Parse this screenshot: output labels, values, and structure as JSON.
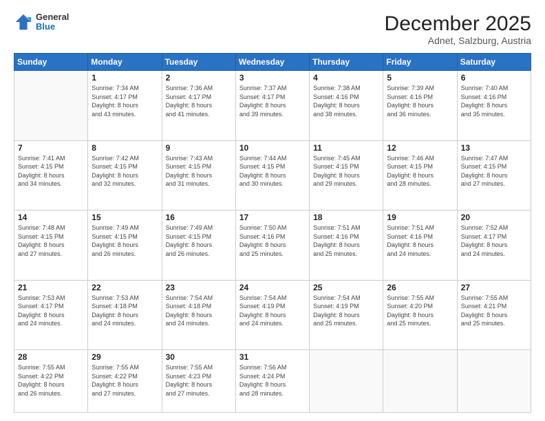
{
  "header": {
    "logo_line1": "General",
    "logo_line2": "Blue",
    "title": "December 2025",
    "subtitle": "Adnet, Salzburg, Austria"
  },
  "weekdays": [
    "Sunday",
    "Monday",
    "Tuesday",
    "Wednesday",
    "Thursday",
    "Friday",
    "Saturday"
  ],
  "weeks": [
    [
      {
        "day": "",
        "info": ""
      },
      {
        "day": "1",
        "info": "Sunrise: 7:34 AM\nSunset: 4:17 PM\nDaylight: 8 hours\nand 43 minutes."
      },
      {
        "day": "2",
        "info": "Sunrise: 7:36 AM\nSunset: 4:17 PM\nDaylight: 8 hours\nand 41 minutes."
      },
      {
        "day": "3",
        "info": "Sunrise: 7:37 AM\nSunset: 4:17 PM\nDaylight: 8 hours\nand 39 minutes."
      },
      {
        "day": "4",
        "info": "Sunrise: 7:38 AM\nSunset: 4:16 PM\nDaylight: 8 hours\nand 38 minutes."
      },
      {
        "day": "5",
        "info": "Sunrise: 7:39 AM\nSunset: 4:16 PM\nDaylight: 8 hours\nand 36 minutes."
      },
      {
        "day": "6",
        "info": "Sunrise: 7:40 AM\nSunset: 4:16 PM\nDaylight: 8 hours\nand 35 minutes."
      }
    ],
    [
      {
        "day": "7",
        "info": "Sunrise: 7:41 AM\nSunset: 4:15 PM\nDaylight: 8 hours\nand 34 minutes."
      },
      {
        "day": "8",
        "info": "Sunrise: 7:42 AM\nSunset: 4:15 PM\nDaylight: 8 hours\nand 32 minutes."
      },
      {
        "day": "9",
        "info": "Sunrise: 7:43 AM\nSunset: 4:15 PM\nDaylight: 8 hours\nand 31 minutes."
      },
      {
        "day": "10",
        "info": "Sunrise: 7:44 AM\nSunset: 4:15 PM\nDaylight: 8 hours\nand 30 minutes."
      },
      {
        "day": "11",
        "info": "Sunrise: 7:45 AM\nSunset: 4:15 PM\nDaylight: 8 hours\nand 29 minutes."
      },
      {
        "day": "12",
        "info": "Sunrise: 7:46 AM\nSunset: 4:15 PM\nDaylight: 8 hours\nand 28 minutes."
      },
      {
        "day": "13",
        "info": "Sunrise: 7:47 AM\nSunset: 4:15 PM\nDaylight: 8 hours\nand 27 minutes."
      }
    ],
    [
      {
        "day": "14",
        "info": "Sunrise: 7:48 AM\nSunset: 4:15 PM\nDaylight: 8 hours\nand 27 minutes."
      },
      {
        "day": "15",
        "info": "Sunrise: 7:49 AM\nSunset: 4:15 PM\nDaylight: 8 hours\nand 26 minutes."
      },
      {
        "day": "16",
        "info": "Sunrise: 7:49 AM\nSunset: 4:15 PM\nDaylight: 8 hours\nand 26 minutes."
      },
      {
        "day": "17",
        "info": "Sunrise: 7:50 AM\nSunset: 4:16 PM\nDaylight: 8 hours\nand 25 minutes."
      },
      {
        "day": "18",
        "info": "Sunrise: 7:51 AM\nSunset: 4:16 PM\nDaylight: 8 hours\nand 25 minutes."
      },
      {
        "day": "19",
        "info": "Sunrise: 7:51 AM\nSunset: 4:16 PM\nDaylight: 8 hours\nand 24 minutes."
      },
      {
        "day": "20",
        "info": "Sunrise: 7:52 AM\nSunset: 4:17 PM\nDaylight: 8 hours\nand 24 minutes."
      }
    ],
    [
      {
        "day": "21",
        "info": "Sunrise: 7:53 AM\nSunset: 4:17 PM\nDaylight: 8 hours\nand 24 minutes."
      },
      {
        "day": "22",
        "info": "Sunrise: 7:53 AM\nSunset: 4:18 PM\nDaylight: 8 hours\nand 24 minutes."
      },
      {
        "day": "23",
        "info": "Sunrise: 7:54 AM\nSunset: 4:18 PM\nDaylight: 8 hours\nand 24 minutes."
      },
      {
        "day": "24",
        "info": "Sunrise: 7:54 AM\nSunset: 4:19 PM\nDaylight: 8 hours\nand 24 minutes."
      },
      {
        "day": "25",
        "info": "Sunrise: 7:54 AM\nSunset: 4:19 PM\nDaylight: 8 hours\nand 25 minutes."
      },
      {
        "day": "26",
        "info": "Sunrise: 7:55 AM\nSunset: 4:20 PM\nDaylight: 8 hours\nand 25 minutes."
      },
      {
        "day": "27",
        "info": "Sunrise: 7:55 AM\nSunset: 4:21 PM\nDaylight: 8 hours\nand 25 minutes."
      }
    ],
    [
      {
        "day": "28",
        "info": "Sunrise: 7:55 AM\nSunset: 4:22 PM\nDaylight: 8 hours\nand 26 minutes."
      },
      {
        "day": "29",
        "info": "Sunrise: 7:55 AM\nSunset: 4:22 PM\nDaylight: 8 hours\nand 27 minutes."
      },
      {
        "day": "30",
        "info": "Sunrise: 7:55 AM\nSunset: 4:23 PM\nDaylight: 8 hours\nand 27 minutes."
      },
      {
        "day": "31",
        "info": "Sunrise: 7:56 AM\nSunset: 4:24 PM\nDaylight: 8 hours\nand 28 minutes."
      },
      {
        "day": "",
        "info": ""
      },
      {
        "day": "",
        "info": ""
      },
      {
        "day": "",
        "info": ""
      }
    ]
  ]
}
